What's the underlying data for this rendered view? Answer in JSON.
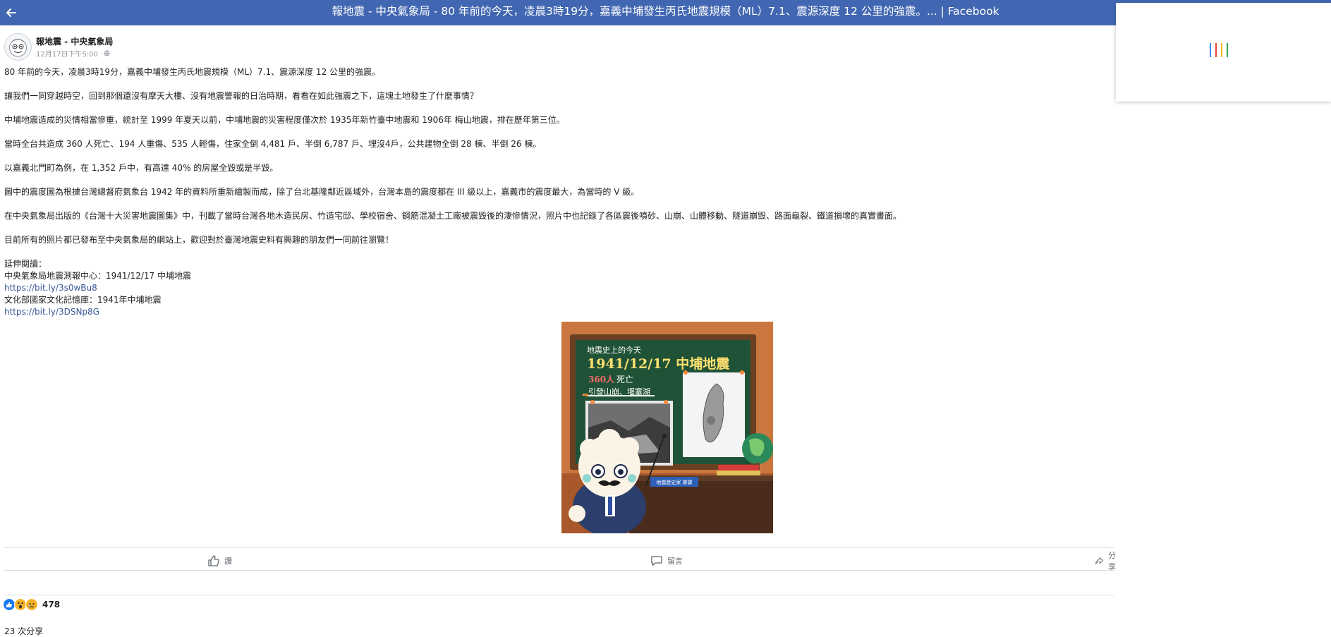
{
  "window": {
    "title": "報地震 - 中央氣象局 - 80 年前的今天，凌晨3時19分，嘉義中埔發生丙氏地震規模（ML）7.1、震源深度 12 公里的強震。... | Facebook"
  },
  "page": {
    "name": "報地震 - 中央氣象局",
    "timestamp": "12月17日下午5:00 · "
  },
  "post": {
    "paragraphs": [
      "80 年前的今天，凌晨3時19分，嘉義中埔發生丙氏地震規模（ML）7.1、震源深度 12 公里的強震。",
      "讓我們一同穿越時空，回到那個還沒有摩天大樓、沒有地震警報的日治時期，看看在如此強震之下，這塊土地發生了什麼事情？",
      "中埔地震造成的災情相當慘重，統計至 1999 年夏天以前，中埔地震的災害程度僅次於 1935年新竹臺中地震和 1906年 梅山地震，排在歷年第三位。",
      "當時全台共造成 360 人死亡、194 人重傷、535 人輕傷，住家全倒 4,481 戶、半倒 6,787 戶、埋沒4戶，公共建物全倒 28 棟、半倒 26 棟。",
      "以嘉義北門町為例，在 1,352 戶中，有高達 40% 的房屋全毀或是半毀。",
      "圖中的震度圖為根據台灣總督府氣象台 1942 年的資料所重新繪製而成，除了台北基隆鄰近區域外，台灣本島的震度都在 III 級以上，嘉義市的震度最大，為當時的 V 級。",
      "在中央氣象局出版的《台灣十大災害地震圖集》中，刊載了當時台灣各地木造民房、竹造宅邸、學校宿舍、鋼筋混凝土工廠被震毀後的淒慘情況，照片中也記錄了各區震後噴砂、山崩、山體移動、隧道崩毀、路面龜裂、鐵道損壞的真實畫面。",
      "目前所有的照片都已發布至中央氣象局的網站上，歡迎對於臺灣地震史料有興趣的朋友們一同前往瀏覽！"
    ],
    "further_reading_label": "延伸閱讀：",
    "ref1_text": "中央氣象局地震測報中心：1941/12/17 中埔地震",
    "ref1_link": "https://bit.ly/3s0wBu8",
    "ref2_text": "文化部國家文化記憶庫：1941年中埔地震",
    "ref2_link": "https://bit.ly/3DSNp8G"
  },
  "image": {
    "heading_small": "地震史上的今天",
    "heading_big": "1941/12/17 中埔地震",
    "deaths_num": "360人",
    "deaths_label": "死亡",
    "effects": "引發山崩、堰塞湖",
    "nameplate": "地震歷史家 賽寶"
  },
  "actions": {
    "like": "讚",
    "comment": "留言",
    "share": "分享"
  },
  "stats": {
    "reaction_count": "478",
    "shares": "23 次分享"
  },
  "colors": {
    "header_bg": "#4267b2",
    "link": "#385898",
    "loader": [
      "#4285f4",
      "#ea4335",
      "#fbbc05",
      "#34a853"
    ],
    "reaction_like": "#1877f2",
    "reaction_wow": "#f7b125",
    "reaction_sad": "#f7b125"
  },
  "icons": {
    "back": "arrow-left-icon",
    "globe": "globe-icon",
    "like": "thumbs-up-icon",
    "comment": "speech-bubble-icon",
    "share": "share-arrow-icon"
  }
}
